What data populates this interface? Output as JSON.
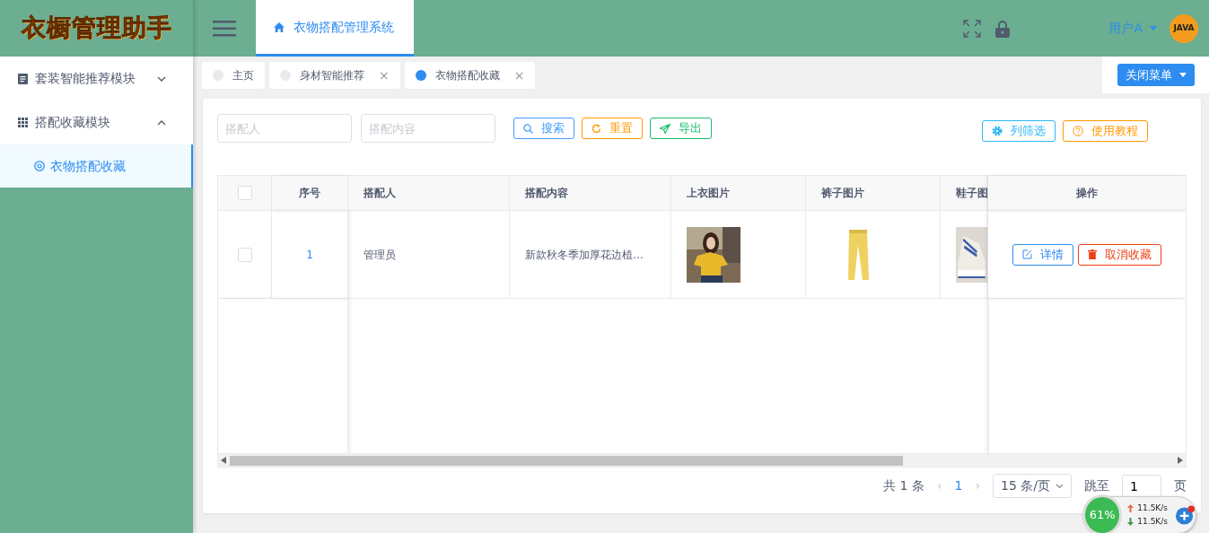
{
  "logo": {
    "text": "衣橱管理助手"
  },
  "header": {
    "tab": {
      "label": "衣物搭配管理系统",
      "selected": true
    },
    "user": "用户A",
    "avatar_text": "JAVA"
  },
  "sidebar": {
    "items": [
      {
        "label": "套装智能推荐模块",
        "expanded": false
      },
      {
        "label": "搭配收藏模块",
        "expanded": true,
        "children": [
          {
            "label": "衣物搭配收藏",
            "selected": true
          }
        ]
      }
    ]
  },
  "tabs": [
    {
      "label": "主页",
      "selected": false
    },
    {
      "label": "身材智能推荐",
      "selected": false,
      "close": "×"
    },
    {
      "label": "衣物搭配收藏",
      "selected": true,
      "close": "×"
    }
  ],
  "close_menu": "关闭菜单",
  "filters": [
    {
      "placeholder": "搭配人"
    },
    {
      "placeholder": "搭配内容"
    }
  ],
  "actions": [
    {
      "label": "搜索",
      "kind": "search",
      "color": "#409eff"
    },
    {
      "label": "重置",
      "kind": "reset",
      "color": "#ff9900"
    },
    {
      "label": "导出",
      "kind": "export",
      "color": "#19be6b"
    }
  ],
  "right_actions": [
    {
      "label": "列筛选",
      "kind": "gear",
      "color": "#2db7f5"
    },
    {
      "label": "使用教程",
      "kind": "help",
      "color": "#ff9900"
    }
  ],
  "table": {
    "select_all": {
      "checked": false
    },
    "columns": [
      "序号",
      "搭配人",
      "搭配内容",
      "上衣图片",
      "裤子图片",
      "鞋子图",
      "操作"
    ],
    "rows": [
      {
        "checked": false,
        "index": "1",
        "person": "管理员",
        "content": "新款秋冬季加厚花边植…",
        "images": [
          {
            "kind": "picture"
          },
          {
            "kind": "picture"
          },
          {
            "kind": "picture"
          }
        ],
        "buttons": [
          {
            "label": "详情",
            "kind": "detail"
          },
          {
            "label": "取消收藏",
            "kind": "delete"
          }
        ]
      }
    ]
  },
  "pagination": {
    "total": "共 1 条",
    "prev": "‹",
    "pages": [
      {
        "label": "1",
        "selected": true
      }
    ],
    "next": "›",
    "page_size": "15 条/页",
    "jump_label": "跳至",
    "jump_value": "1",
    "page_unit": "页"
  },
  "net_widget": {
    "percent": "61%",
    "up": "11.5K/s",
    "down": "11.5K/s"
  }
}
